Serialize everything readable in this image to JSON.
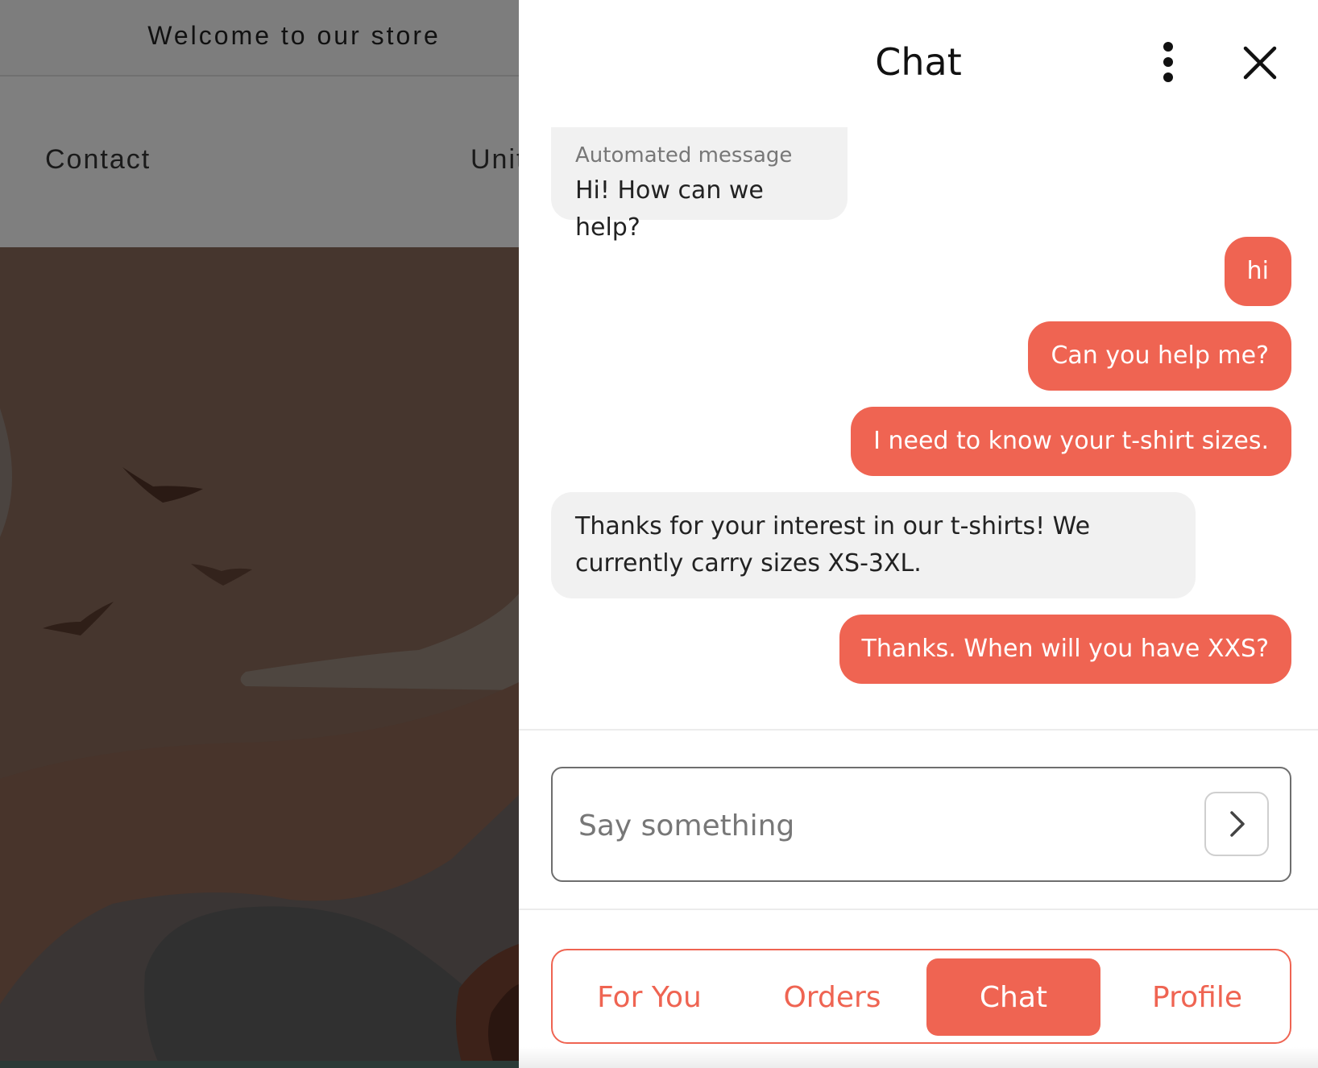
{
  "store": {
    "welcome_text": "Welcome to our store",
    "nav": {
      "contact": "Contact",
      "partial": "Unit"
    }
  },
  "chat": {
    "title": "Chat",
    "menu_icon": "more-vertical-icon",
    "close_icon": "close-icon",
    "messages": [
      {
        "from": "bot",
        "label": "Automated message",
        "text": "Hi! How can we help?"
      },
      {
        "from": "user",
        "text": "hi"
      },
      {
        "from": "user",
        "text": "Can you help me?"
      },
      {
        "from": "user",
        "text": "I need to know your t-shirt sizes."
      },
      {
        "from": "bot",
        "text": "Thanks for your interest in our t-shirts! We currently carry sizes XS-3XL."
      },
      {
        "from": "user",
        "text": "Thanks. When will you have XXS?"
      }
    ],
    "input": {
      "placeholder": "Say something",
      "value": ""
    },
    "send_icon": "chevron-right-icon"
  },
  "tabs": {
    "items": [
      {
        "label": "For You",
        "active": false
      },
      {
        "label": "Orders",
        "active": false
      },
      {
        "label": "Chat",
        "active": true
      },
      {
        "label": "Profile",
        "active": false
      }
    ]
  },
  "colors": {
    "accent": "#ef6452",
    "bot_bubble": "#f1f1f1",
    "overlay": "#7f7f7f"
  }
}
